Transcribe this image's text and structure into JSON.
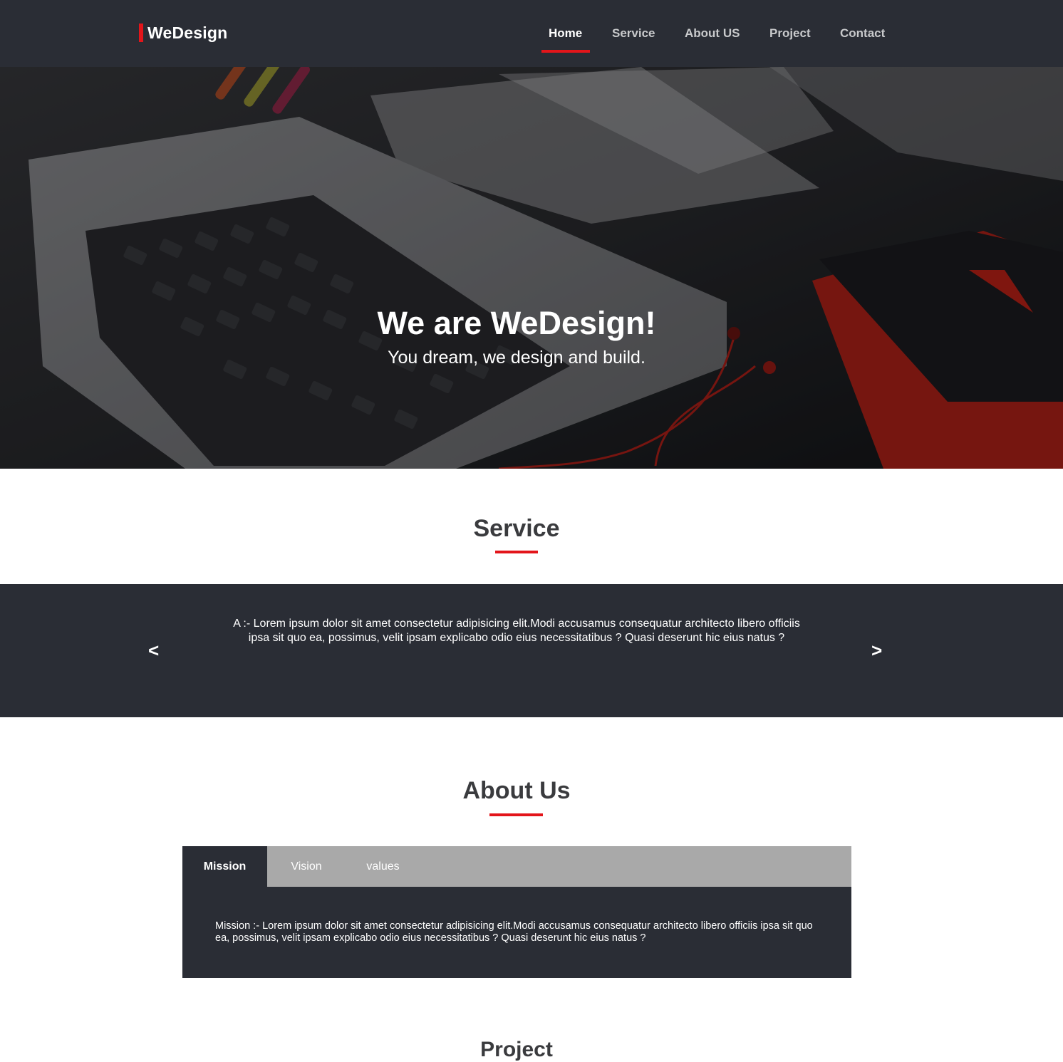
{
  "brand": {
    "name": "WeDesign",
    "accent": "#e3151a",
    "dark": "#2a2d35"
  },
  "nav": {
    "items": [
      {
        "label": "Home",
        "active": true
      },
      {
        "label": "Service"
      },
      {
        "label": "About US"
      },
      {
        "label": "Project"
      },
      {
        "label": "Contact"
      }
    ]
  },
  "hero": {
    "title": "We are WeDesign!",
    "subtitle": "You dream, we design and build."
  },
  "service": {
    "title": "Service",
    "prev_label": "<",
    "next_label": ">",
    "slide_text": "A :- Lorem ipsum dolor sit amet consectetur adipisicing elit.Modi accusamus consequatur architecto libero officiis ipsa sit quo ea, possimus, velit ipsam explicabo odio eius necessitatibus ? Quasi deserunt hic eius natus ?"
  },
  "about": {
    "title": "About Us",
    "tabs": [
      {
        "label": "Mission",
        "active": true
      },
      {
        "label": "Vision"
      },
      {
        "label": "values"
      }
    ],
    "panel_text": "Mission :- Lorem ipsum dolor sit amet consectetur adipisicing elit.Modi accusamus consequatur architecto libero officiis ipsa sit quo ea, possimus, velit ipsam explicabo odio eius necessitatibus ? Quasi deserunt hic eius natus ?"
  },
  "project": {
    "title": "Project"
  }
}
